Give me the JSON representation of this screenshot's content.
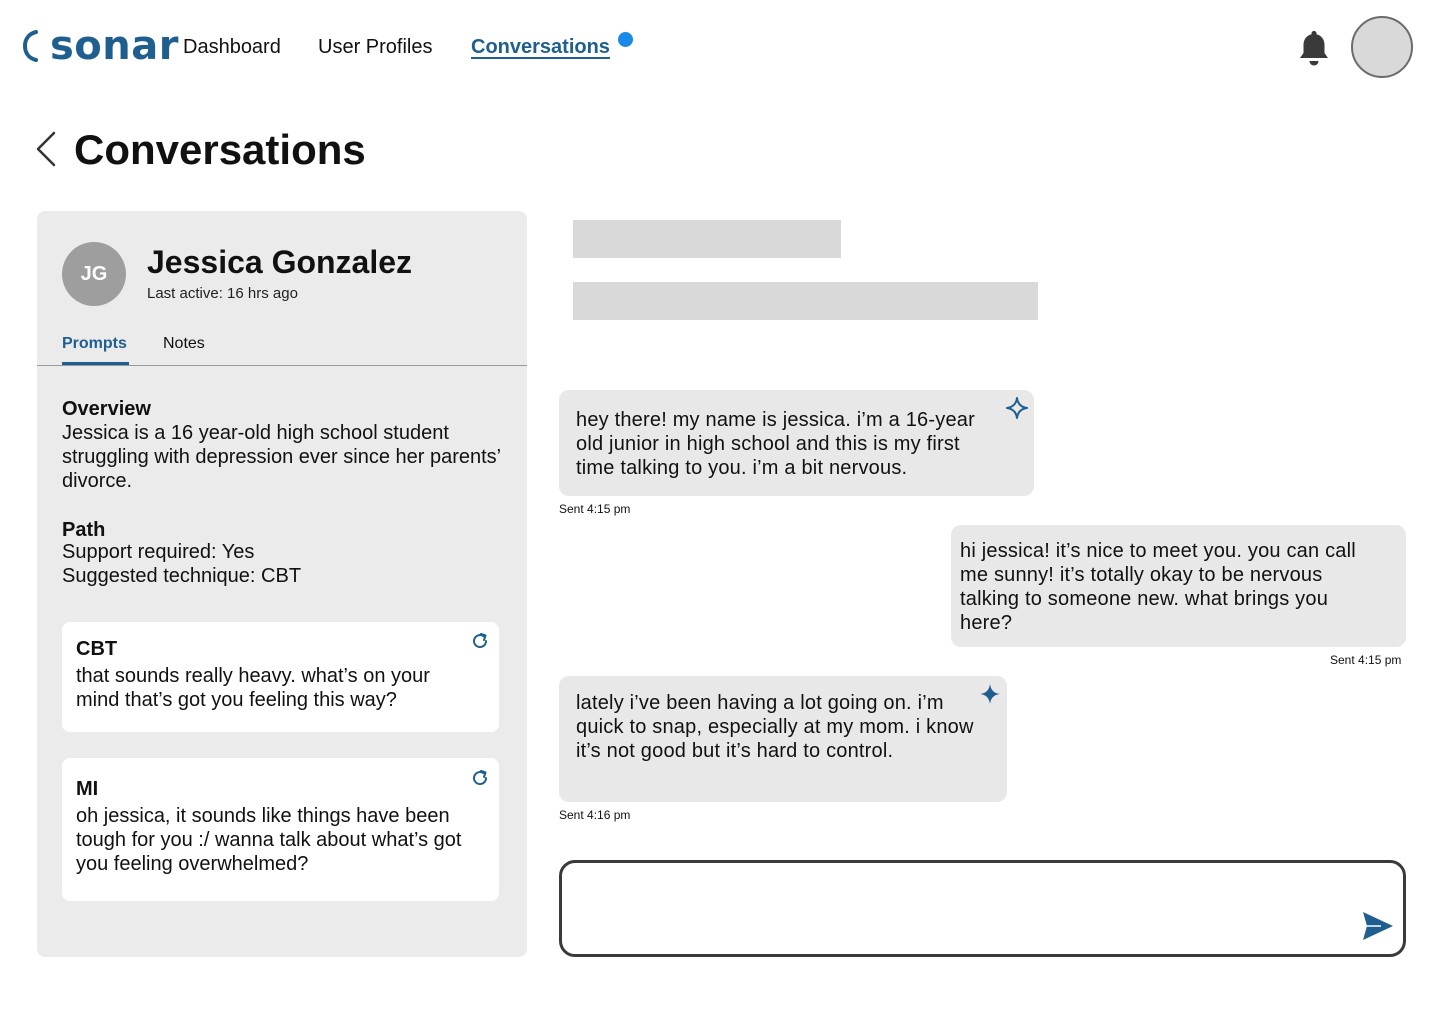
{
  "brand": {
    "name": "sonar",
    "color": "#1f5f8f"
  },
  "nav": {
    "items": [
      {
        "label": "Dashboard"
      },
      {
        "label": "User Profiles"
      },
      {
        "label": "Conversations"
      }
    ],
    "active": "Conversations",
    "notification_dot_color": "#1a8ae8"
  },
  "header_icons": [
    "bell-icon",
    "user-avatar"
  ],
  "page": {
    "title": "Conversations"
  },
  "profile": {
    "initials": "JG",
    "name": "Jessica Gonzalez",
    "last_active": "Last active: 16 hrs ago",
    "tabs": [
      {
        "label": "Prompts",
        "active": true
      },
      {
        "label": "Notes",
        "active": false
      }
    ],
    "overview": {
      "title": "Overview",
      "text": "Jessica is a 16 year-old high school student struggling with depression ever since her parents’ divorce."
    },
    "path": {
      "title": "Path",
      "support": "Support required: Yes",
      "technique": "Suggested technique: CBT"
    },
    "prompts": [
      {
        "technique": "CBT",
        "text": "that sounds really heavy. what’s on your mind that’s got you feeling this way?"
      },
      {
        "technique": "MI",
        "text": "oh jessica, it sounds like things have been tough for you :/ wanna talk about what’s got you feeling overwhelmed?"
      }
    ]
  },
  "chat": {
    "messages": [
      {
        "from": "user",
        "text": "hey there! my name is jessica. i’m a 16-year old junior in high school and this is my first time talking to you. i’m a bit nervous.",
        "time": "Sent 4:15 pm",
        "ai_flag": "sparkle-outline-icon"
      },
      {
        "from": "bot",
        "text": "hi jessica! it’s nice to meet you. you can call me sunny! it’s totally okay to be nervous talking to someone new. what brings you here?",
        "time": "Sent 4:15 pm"
      },
      {
        "from": "user",
        "text": "lately i’ve been having a lot going on. i’m quick to snap, especially at my mom. i know it’s not good but it’s hard to control.",
        "time": "Sent 4:16 pm",
        "ai_flag": "sparkle-filled-icon"
      }
    ],
    "composer": {
      "placeholder": ""
    }
  }
}
